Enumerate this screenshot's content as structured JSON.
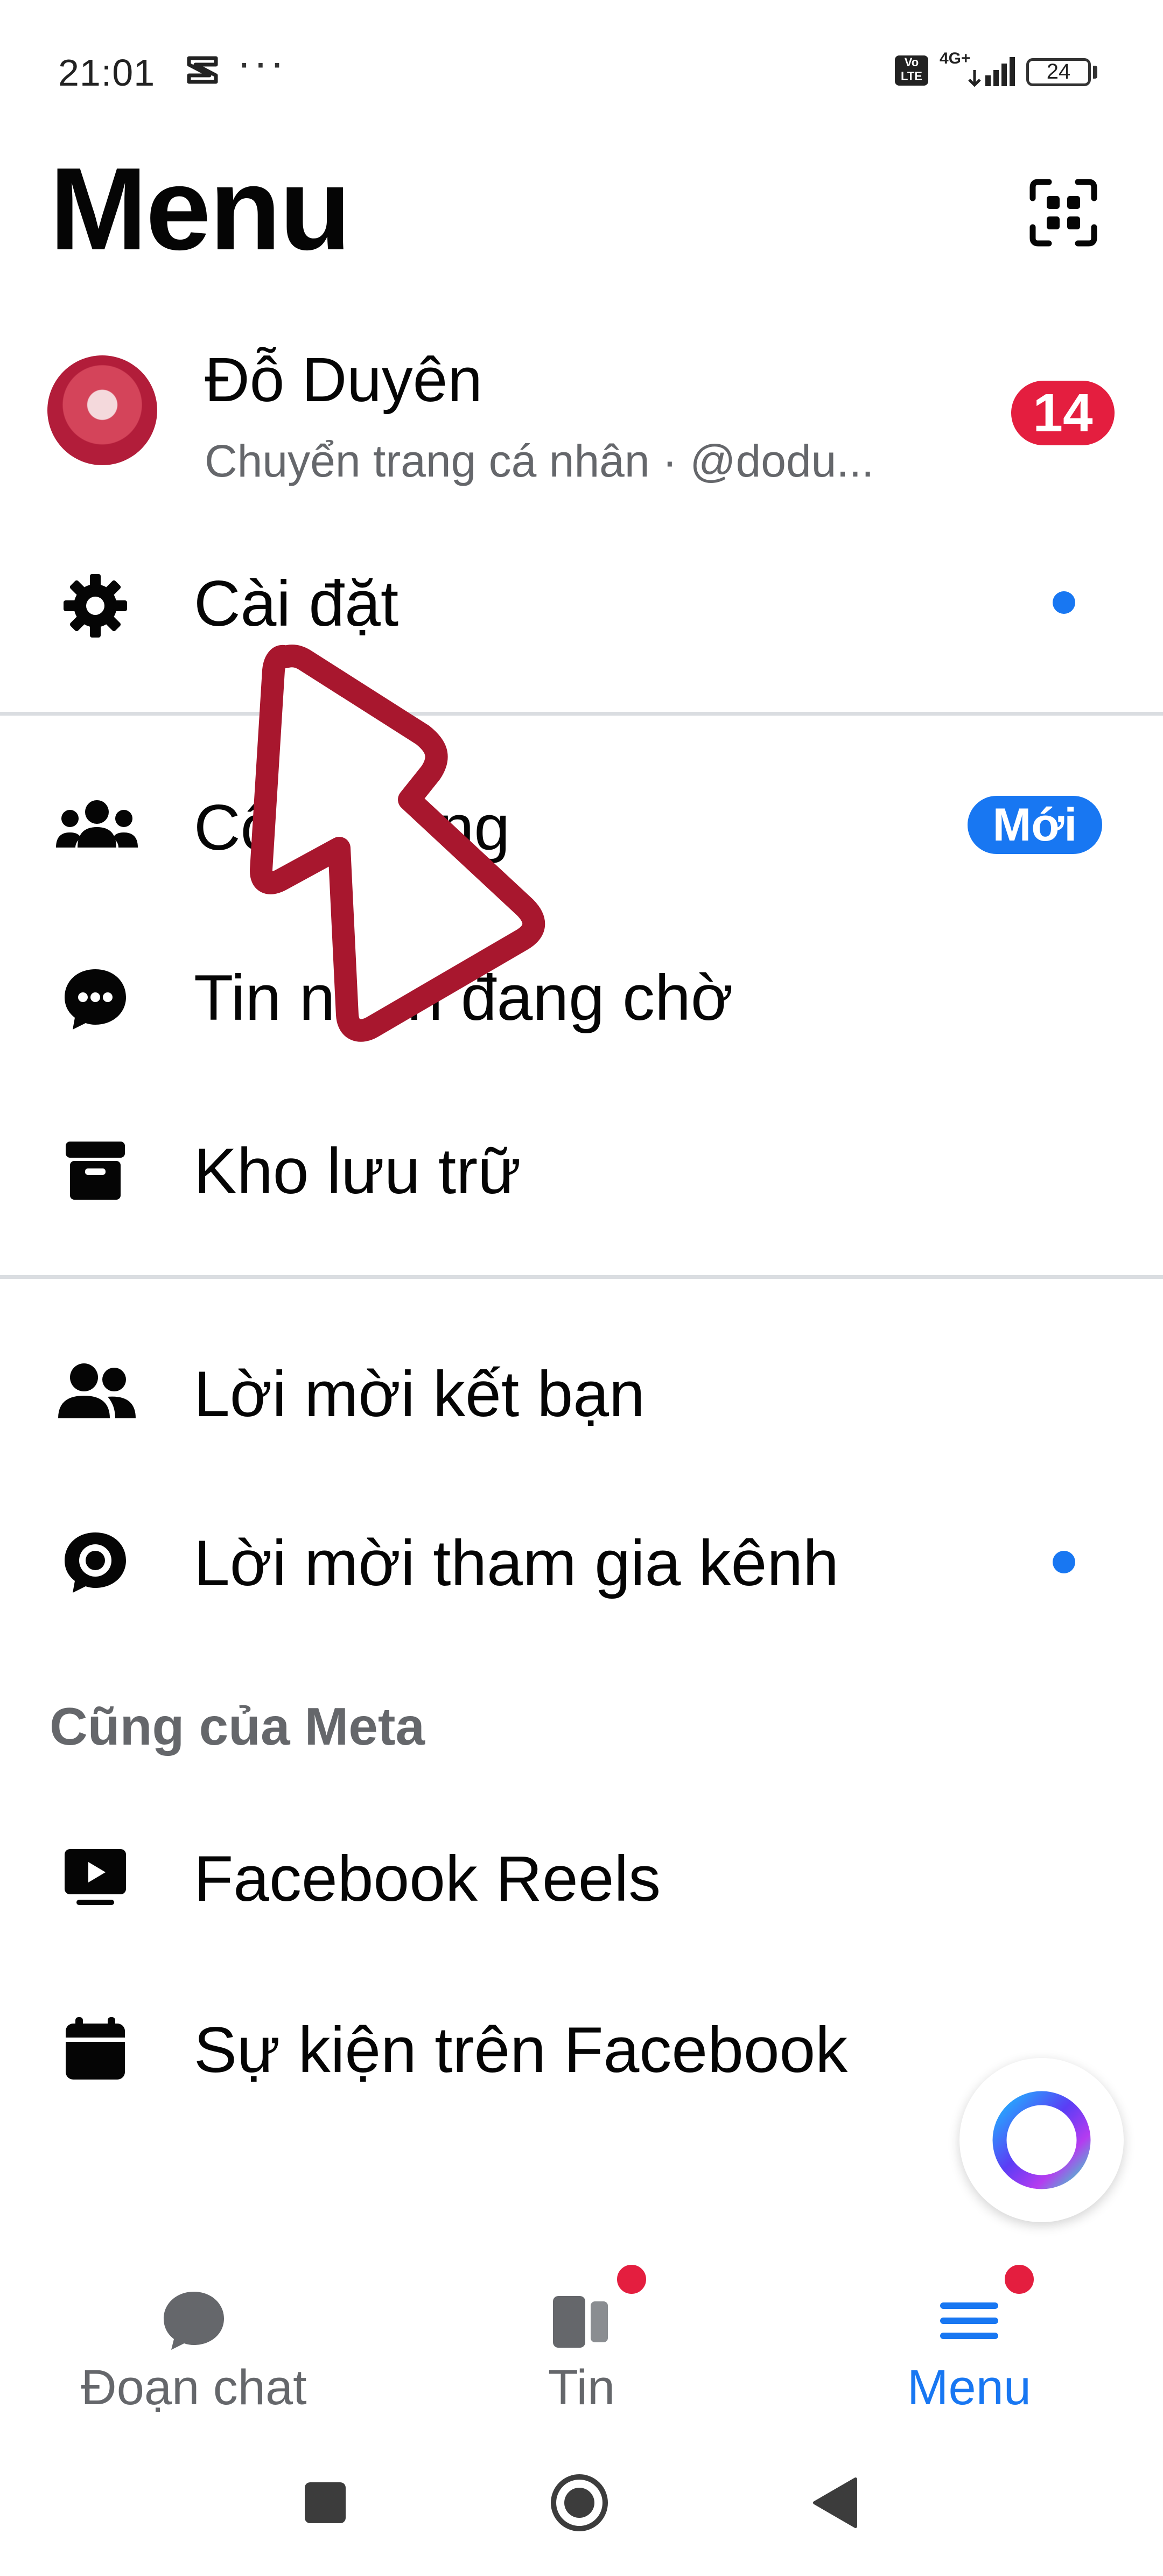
{
  "status_bar": {
    "time": "21:01",
    "dots": "···",
    "volte": "Vo LTE",
    "network": "4G+",
    "battery": "24"
  },
  "header": {
    "title": "Menu",
    "qr_icon": "qr-scan-icon"
  },
  "profile": {
    "name": "Đỗ Duyên",
    "subtitle": "Chuyển trang cá nhân · @dodu...",
    "badge_count": "14"
  },
  "menu_items": [
    {
      "icon": "gear-icon",
      "label": "Cài đặt",
      "blue_dot": true
    },
    {
      "icon": "community-icon",
      "label": "Cộng đồng",
      "pill": "Mới"
    },
    {
      "icon": "chat-bubble-dots-icon",
      "label": "Tin nhắn đang chờ"
    },
    {
      "icon": "archive-box-icon",
      "label": "Kho lưu trữ"
    },
    {
      "icon": "friends-icon",
      "label": "Lời mời kết bạn"
    },
    {
      "icon": "channel-chat-icon",
      "label": "Lời mời tham gia kênh",
      "blue_dot": true
    }
  ],
  "meta_section": {
    "title": "Cũng của Meta",
    "items": [
      {
        "icon": "video-play-icon",
        "label": "Facebook Reels"
      },
      {
        "icon": "calendar-icon",
        "label": "Sự kiện trên Facebook"
      }
    ]
  },
  "bottom_nav": {
    "tabs": [
      {
        "label": "Đoạn chat",
        "icon": "chat-bubble-icon",
        "active": false,
        "dot": false
      },
      {
        "label": "Tin",
        "icon": "stories-icon",
        "active": false,
        "dot": true
      },
      {
        "label": "Menu",
        "icon": "hamburger-menu-icon",
        "active": true,
        "dot": true
      }
    ]
  },
  "colors": {
    "accent": "#1877f2",
    "notification": "#e41e3f",
    "secondary_text": "#65676b",
    "arrow_overlay": "#a8172e"
  }
}
